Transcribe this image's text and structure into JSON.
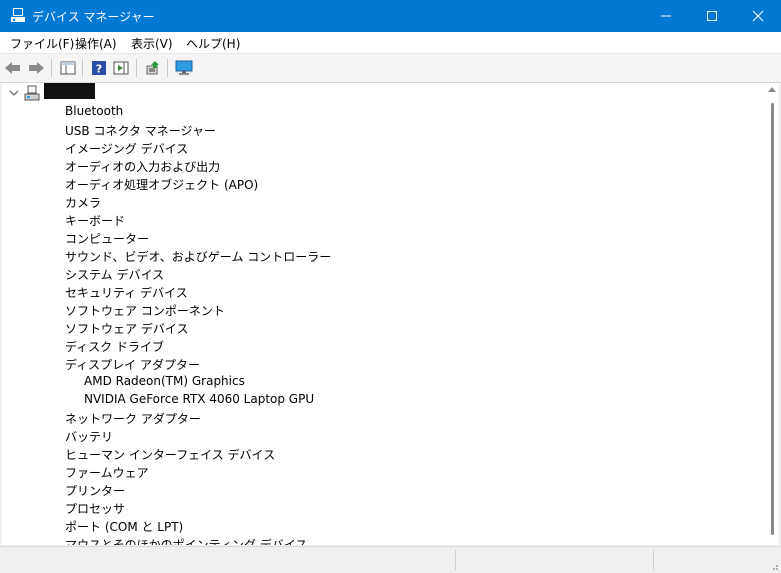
{
  "window": {
    "title": "デバイス マネージャー"
  },
  "menu": [
    "ファイル(F)",
    "操作(A)",
    "表示(V)",
    "ヘルプ(H)"
  ],
  "tree": {
    "root_name": "",
    "categories": [
      {
        "label": "Bluetooth",
        "icon": "bluetooth-icon"
      },
      {
        "label": "USB コネクタ マネージャー",
        "icon": "usb-connector-icon"
      },
      {
        "label": "イメージング デバイス",
        "icon": "camera-device-icon"
      },
      {
        "label": "オーディオの入力および出力",
        "icon": "speaker-icon"
      },
      {
        "label": "オーディオ処理オブジェクト (APO)",
        "icon": "speaker-icon"
      },
      {
        "label": "カメラ",
        "icon": "webcam-icon"
      },
      {
        "label": "キーボード",
        "icon": "keyboard-icon"
      },
      {
        "label": "コンピューター",
        "icon": "monitor-icon"
      },
      {
        "label": "サウンド、ビデオ、およびゲーム コントローラー",
        "icon": "speaker-icon"
      },
      {
        "label": "システム デバイス",
        "icon": "system-device-icon"
      },
      {
        "label": "セキュリティ デバイス",
        "icon": "security-key-icon"
      },
      {
        "label": "ソフトウェア コンポーネント",
        "icon": "software-component-icon"
      },
      {
        "label": "ソフトウェア デバイス",
        "icon": "software-device-icon"
      },
      {
        "label": "ディスク ドライブ",
        "icon": "disk-drive-icon"
      },
      {
        "label": "ディスプレイ アダプター",
        "icon": "display-adapter-icon",
        "expanded": true,
        "children": [
          "AMD Radeon(TM) Graphics",
          "NVIDIA GeForce RTX 4060 Laptop GPU"
        ]
      },
      {
        "label": "ネットワーク アダプター",
        "icon": "network-adapter-icon"
      },
      {
        "label": "バッテリ",
        "icon": "battery-icon"
      },
      {
        "label": "ヒューマン インターフェイス デバイス",
        "icon": "hid-icon"
      },
      {
        "label": "ファームウェア",
        "icon": "firmware-icon"
      },
      {
        "label": "プリンター",
        "icon": "printer-icon"
      },
      {
        "label": "プロセッサ",
        "icon": "processor-icon"
      },
      {
        "label": "ポート (COM と LPT)",
        "icon": "port-icon"
      },
      {
        "label": "マウスとそのほかのポインティング デバイス",
        "icon": "mouse-icon"
      }
    ]
  },
  "colors": {
    "titlebar": "#0078d4",
    "monitor_blue": "#2f9be0",
    "chevron": "#6e6e6e"
  }
}
